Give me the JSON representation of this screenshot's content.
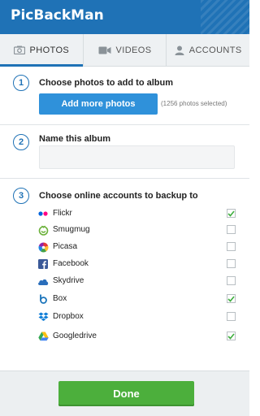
{
  "app": {
    "title": "PicBackMan"
  },
  "tabs": [
    {
      "label": "PHOTOS",
      "icon": "camera-icon",
      "active": true
    },
    {
      "label": "VIDEOS",
      "icon": "video-camera-icon",
      "active": false
    },
    {
      "label": "ACCOUNTS",
      "icon": "user-icon",
      "active": false
    }
  ],
  "steps": {
    "one": {
      "number": "1",
      "title": "Choose photos to add to album",
      "button_label": "Add more photos",
      "photo_count": "(1256 photos selected)"
    },
    "two": {
      "number": "2",
      "title": "Name this album",
      "input_value": "",
      "input_placeholder": ""
    },
    "three": {
      "number": "3",
      "title": "Choose online accounts to backup to"
    }
  },
  "accounts": [
    {
      "label": "Flickr",
      "icon": "flickr-icon",
      "checked": true
    },
    {
      "label": "Smugmug",
      "icon": "smugmug-icon",
      "checked": false
    },
    {
      "label": "Picasa",
      "icon": "picasa-icon",
      "checked": false
    },
    {
      "label": "Facebook",
      "icon": "facebook-icon",
      "checked": false
    },
    {
      "label": "Skydrive",
      "icon": "skydrive-icon",
      "checked": false
    },
    {
      "label": "Box",
      "icon": "box-icon",
      "checked": true
    },
    {
      "label": "Dropbox",
      "icon": "dropbox-icon",
      "checked": false
    },
    {
      "label": "Googledrive",
      "icon": "googledrive-icon",
      "checked": true
    }
  ],
  "footer": {
    "done_label": "Done"
  },
  "colors": {
    "primary": "#1f72b6",
    "button_blue": "#2f91da",
    "done_green": "#4caf3c",
    "check_green": "#3fae3f"
  }
}
